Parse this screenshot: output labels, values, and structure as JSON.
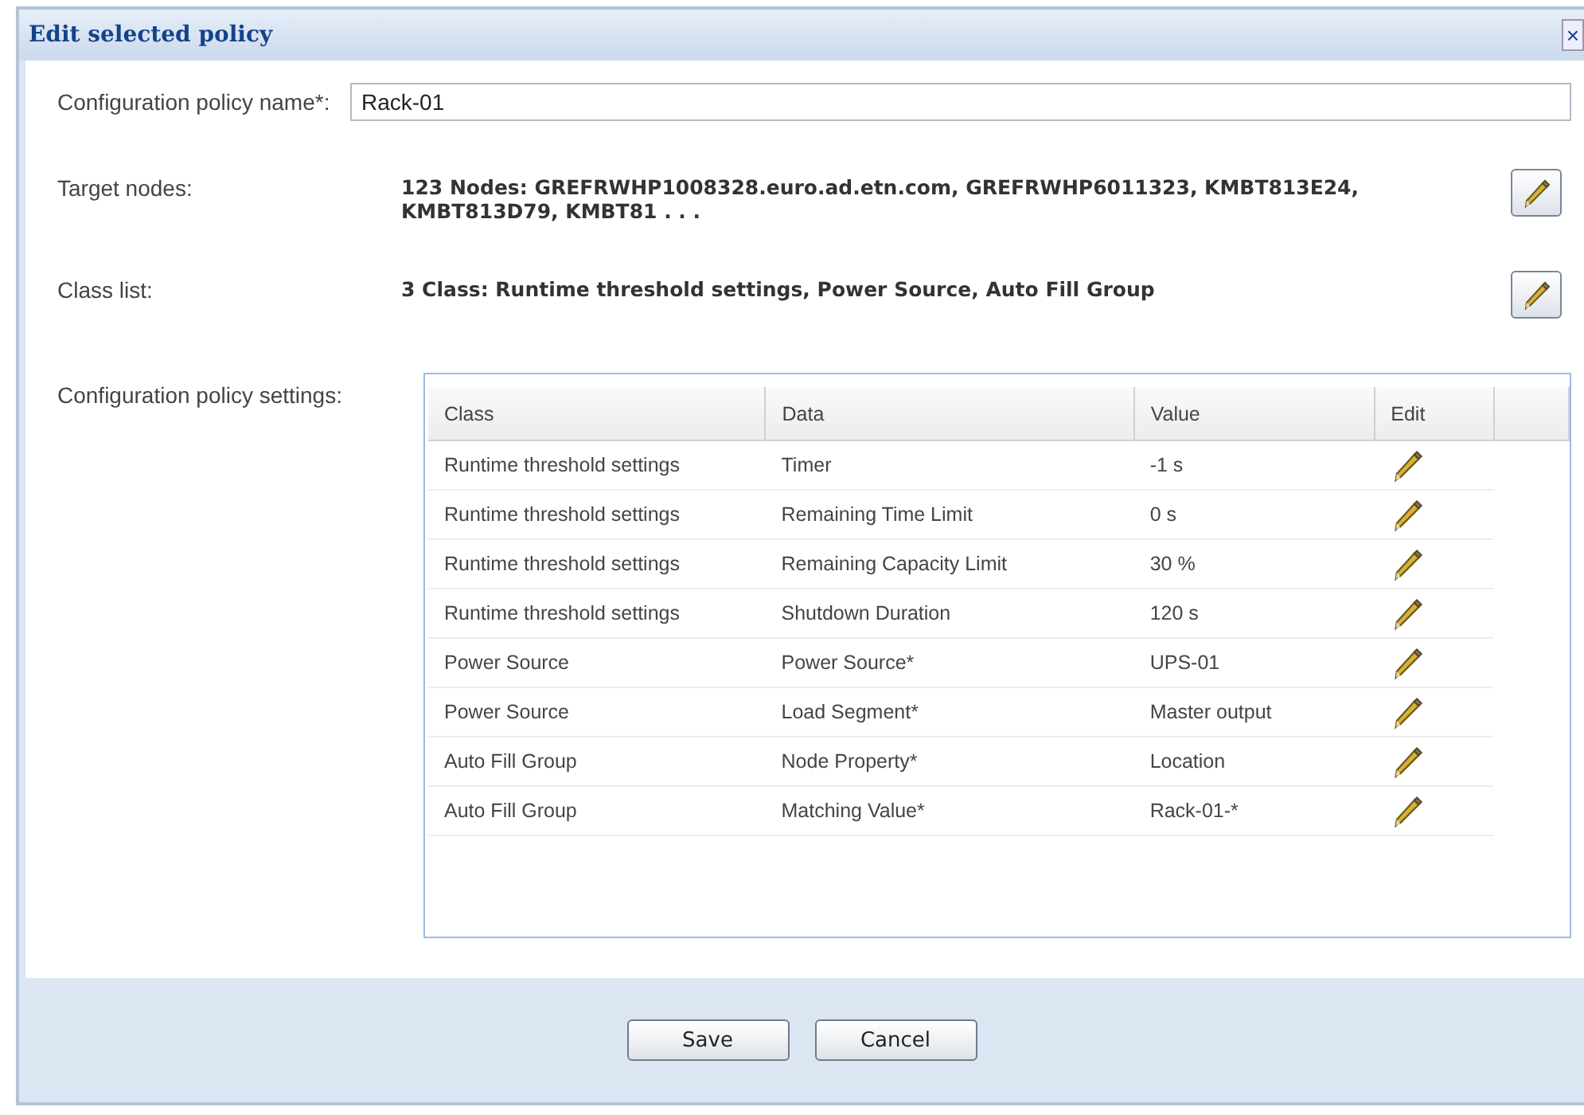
{
  "window": {
    "title": "Edit selected policy",
    "close": "×"
  },
  "fields": [
    {
      "label": "Configuration policy name*:",
      "value": "Rack-01"
    }
  ],
  "summaries": [
    {
      "label": "Target nodes:",
      "text": "123 Nodes: GREFRWHP1008328.euro.ad.etn.com, GREFRWHP6011323, KMBT813E24, KMBT813D79, KMBT81 . . ."
    },
    {
      "label": "Class list:",
      "text": "3 Class: Runtime threshold settings, Power Source, Auto Fill Group"
    }
  ],
  "settings": {
    "label": "Configuration policy settings:",
    "table": {
      "columns": [
        "Class",
        "Data",
        "Value",
        "Edit"
      ],
      "rows": [
        {
          "class": "Runtime threshold settings",
          "data": "Timer",
          "value": "-1 s"
        },
        {
          "class": "Runtime threshold settings",
          "data": "Remaining Time Limit",
          "value": "0 s"
        },
        {
          "class": "Runtime threshold settings",
          "data": "Remaining Capacity Limit",
          "value": "30 %"
        },
        {
          "class": "Runtime threshold settings",
          "data": "Shutdown Duration",
          "value": "120 s"
        },
        {
          "class": "Power Source",
          "data": "Power Source*",
          "value": "UPS-01"
        },
        {
          "class": "Power Source",
          "data": "Load Segment*",
          "value": "Master output"
        },
        {
          "class": "Auto Fill Group",
          "data": "Node Property*",
          "value": "Location"
        },
        {
          "class": "Auto Fill Group",
          "data": "Matching Value*",
          "value": "Rack-01-*"
        }
      ]
    }
  },
  "buttons": [
    "Save",
    "Cancel"
  ]
}
